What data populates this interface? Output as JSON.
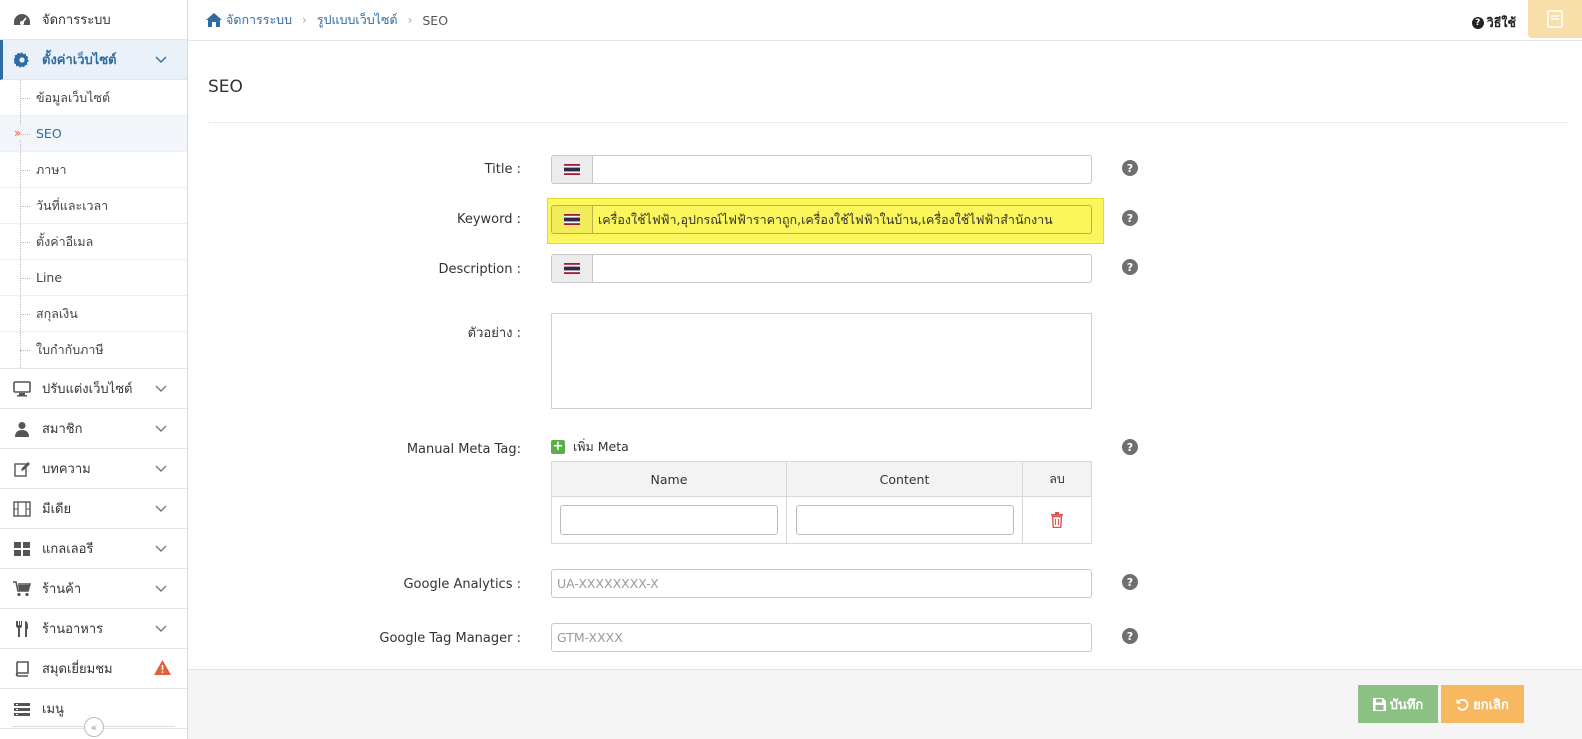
{
  "sidebar": {
    "items": [
      {
        "label": "จัดการระบบ",
        "icon": "dashboard-icon"
      },
      {
        "label": "ตั้งค่าเว็บไซต์",
        "icon": "gear-icon",
        "active": true
      },
      {
        "label": "ปรับแต่งเว็บไซต์",
        "icon": "monitor-icon"
      },
      {
        "label": "สมาชิก",
        "icon": "user-icon"
      },
      {
        "label": "บทความ",
        "icon": "edit-icon"
      },
      {
        "label": "มีเดีย",
        "icon": "film-icon"
      },
      {
        "label": "แกลเลอรี",
        "icon": "gallery-grid-icon"
      },
      {
        "label": "ร้านค้า",
        "icon": "cart-icon"
      },
      {
        "label": "ร้านอาหาร",
        "icon": "utensils-icon"
      },
      {
        "label": "สมุดเยี่ยมชม",
        "icon": "guestbook-icon",
        "warning": true
      },
      {
        "label": "เมนู",
        "icon": "menu-list-icon"
      }
    ],
    "submenu": [
      "ข้อมูลเว็บไซต์",
      "SEO",
      "ภาษา",
      "วันที่และเวลา",
      "ตั้งค่าอีเมล",
      "Line",
      "สกุลเงิน",
      "ใบกำกับภาษี"
    ],
    "current_mark": "»",
    "collapse_icon": "«"
  },
  "breadcrumb": {
    "home": "จัดการระบบ",
    "section": "รูปแบบเว็บไซต์",
    "current": "SEO",
    "sep": "›"
  },
  "topbar": {
    "howto": "วิธีใช้",
    "howto_icon": "?"
  },
  "page": {
    "title": "SEO"
  },
  "form": {
    "title_label": "Title :",
    "title_value": "",
    "keyword_label": "Keyword :",
    "keyword_value": "เครื่องใช้ไฟฟ้า,อุปกรณ์ไฟฟ้าราคาถูก,เครื่องใช้ไฟฟ้าในบ้าน,เครื่องใช้ไฟฟ้าสำนักงาน",
    "description_label": "Description :",
    "description_value": "",
    "example_label": "ตัวอย่าง :",
    "manual_meta_label": "Manual Meta Tag:",
    "add_meta": "เพิ่ม Meta",
    "add_meta_icon": "+",
    "meta_columns": [
      "Name",
      "Content",
      "ลบ"
    ],
    "ga_label": "Google Analytics :",
    "ga_placeholder": "UA-XXXXXXXX-X",
    "gtm_label": "Google Tag Manager :",
    "gtm_placeholder": "GTM-XXXX",
    "help_icon": "?"
  },
  "footer": {
    "save": "บันทึก",
    "cancel": "ยกเลิก"
  },
  "colors": {
    "accent": "#2e6da4",
    "save": "#8bc283",
    "cancel": "#f7b85f",
    "highlight": "#fbf65c",
    "warning": "#e0603a"
  }
}
